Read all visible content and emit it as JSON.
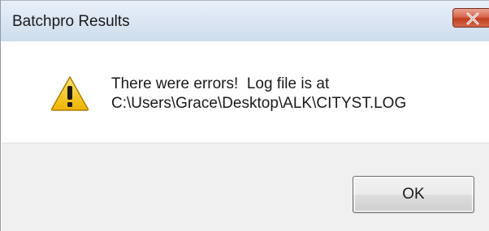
{
  "window": {
    "title": "Batchpro Results"
  },
  "dialog": {
    "icon": "warning-icon",
    "message_line1": "There were errors!  Log file is at",
    "message_line2": "C:\\Users\\Grace\\Desktop\\ALK\\CITYST.LOG"
  },
  "buttons": {
    "ok_label": "OK"
  },
  "colors": {
    "close_button": "#c94a2c",
    "warning_fill": "#f5c518",
    "footer_background": "#f0f0f0"
  }
}
